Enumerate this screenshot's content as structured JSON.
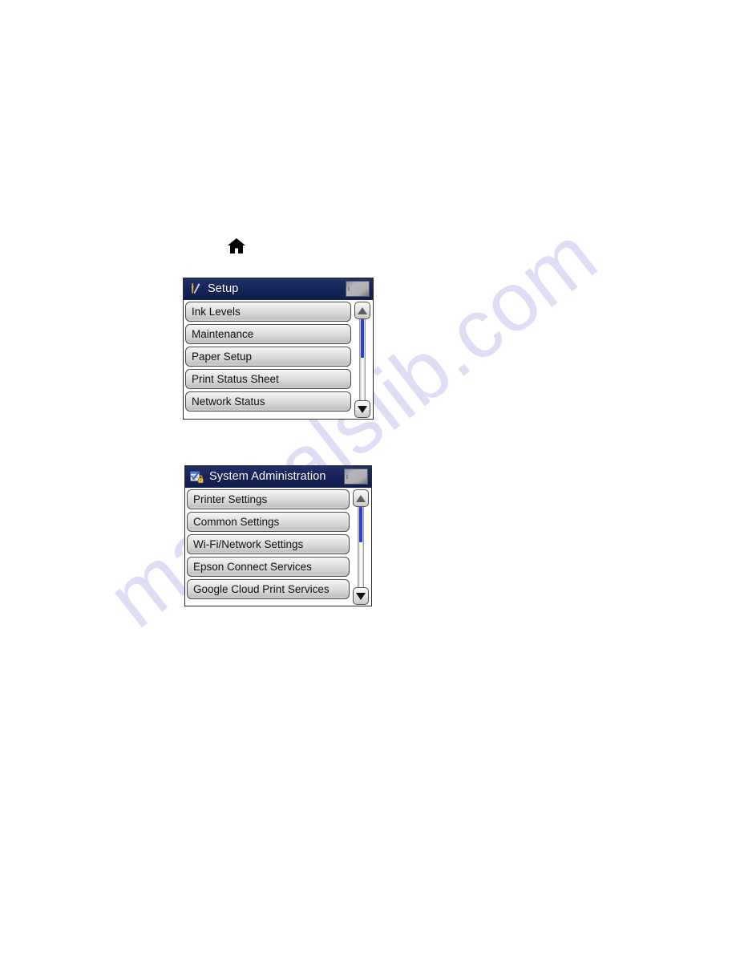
{
  "page": {
    "background_color": "#ffffff",
    "watermark_text": "manualslib.com",
    "watermark_color": "#c9c9ef"
  },
  "home_step": {
    "icon": "home-icon",
    "icon_color": "#000000"
  },
  "panels": [
    {
      "id": "setup-panel",
      "title": "Setup",
      "title_icon": "wrench-screwdriver-icon",
      "title_bar_color": "#16255a",
      "badge_glyph": "i",
      "items": [
        "Ink Levels",
        "Maintenance",
        "Paper Setup",
        "Print Status Sheet",
        "Network Status"
      ],
      "scrollbar": {
        "up_arrow": "triangle-up-icon",
        "down_arrow": "triangle-down-icon",
        "thumb_color": "#2b3fd0",
        "thumb_top_pct": 2,
        "thumb_height_pct": 46
      }
    },
    {
      "id": "system-administration-panel",
      "title": "System Administration",
      "title_icon": "clipboard-lock-icon",
      "title_bar_color": "#16255a",
      "badge_glyph": "i",
      "items": [
        "Printer Settings",
        "Common Settings",
        "Wi-Fi/Network Settings",
        "Epson Connect Services",
        "Google Cloud Print Services"
      ],
      "scrollbar": {
        "up_arrow": "triangle-up-icon",
        "down_arrow": "triangle-down-icon",
        "thumb_color": "#2b3fd0",
        "thumb_top_pct": 2,
        "thumb_height_pct": 42
      }
    }
  ]
}
